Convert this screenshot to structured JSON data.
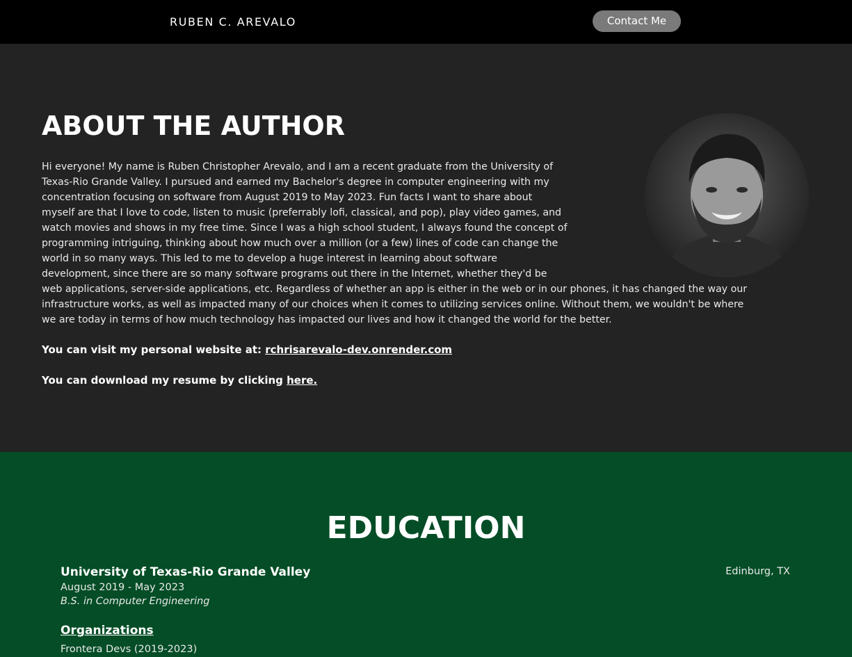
{
  "navbar": {
    "brand": "RUBEN C. AREVALO",
    "contact_label": "Contact Me"
  },
  "about": {
    "title": "ABOUT THE AUTHOR",
    "avatar_icon": "profile-photo-icon",
    "bio_lines": [
      "Hi everyone! My name is Ruben Christopher Arevalo, and I am a recent graduate from the University of",
      "Texas-Rio Grande Valley. I pursued and earned my Bachelor's degree in computer engineering with my",
      "concentration focusing on software from August 2019 to May 2023. Fun facts I want to share about",
      "myself are that I love to code, listen to music (preferrably lofi, classical, and pop), play video games, and",
      "watch movies and shows in my free time. Since I was a high school student, I always found the concept of",
      "programming intriguing, thinking about how much over a million (or a few) lines of code can change the",
      "world in so many ways. This led to me to develop a huge interest in learning about software",
      "development, since there are so many software programs out there in the Internet, whether they'd be",
      "web applications, server-side applications, etc. Regardless of whether an app is either in the web or in our phones, it has changed the way our",
      "infrastructure works, as well as impacted many of our choices when it comes to utilizing services online. Without them, we wouldn't be where",
      "we are today in terms of how much technology has impacted our lives and how it changed the world for the better."
    ],
    "website_prefix": "You can visit my personal website at: ",
    "website_link": "rchrisarevalo-dev.onrender.com",
    "resume_prefix": "You can download my resume by clicking ",
    "resume_link": "here."
  },
  "education": {
    "title": "EDUCATION",
    "school_name": "University of Texas-Rio Grande Valley",
    "location": "Edinburg, TX",
    "dates": "August 2019 - May 2023",
    "degree": "B.S. in Computer Engineering",
    "organizations_heading": "Organizations",
    "organizations": [
      "Frontera Devs (2019-2023)"
    ]
  },
  "colors": {
    "navbar_bg": "#000000",
    "about_bg": "#232323",
    "education_bg": "#044d26",
    "contact_button_bg": "#7a7a7a"
  }
}
